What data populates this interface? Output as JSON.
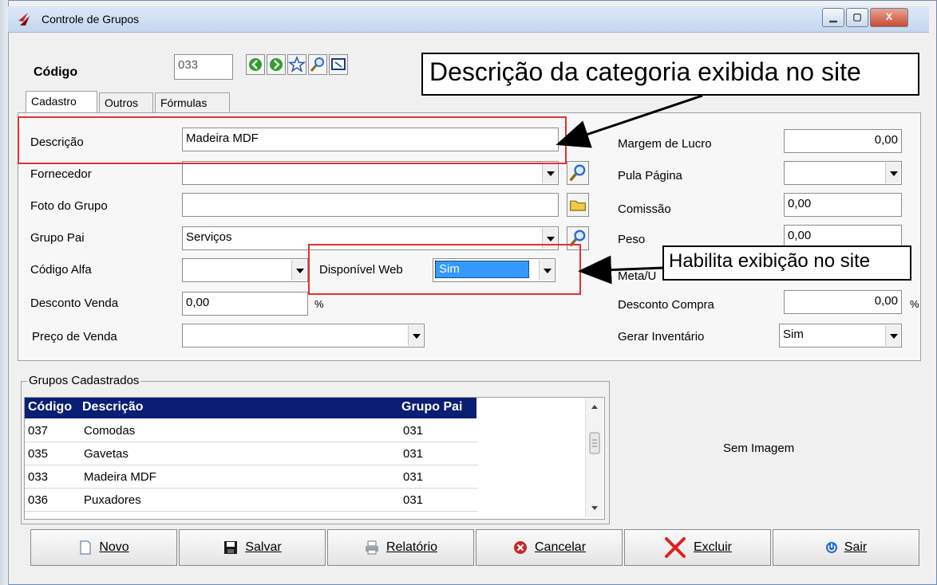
{
  "window": {
    "title": "Controle de Grupos",
    "minimize_glyph": "▁",
    "maximize_glyph": "▢",
    "close_glyph": "X"
  },
  "header": {
    "codigo_label": "Código",
    "codigo_value": "033"
  },
  "tabs": [
    {
      "label": "Cadastro"
    },
    {
      "label": "Outros"
    },
    {
      "label": "Fórmulas"
    }
  ],
  "form_left": {
    "descricao_label": "Descrição",
    "descricao_value": "Madeira MDF",
    "fornecedor_label": "Fornecedor",
    "fornecedor_value": "",
    "foto_label": "Foto do Grupo",
    "foto_value": "",
    "grupo_pai_label": "Grupo Pai",
    "grupo_pai_value": "Serviços",
    "codigo_alfa_label": "Código Alfa",
    "codigo_alfa_value": "",
    "disponivel_web_label": "Disponível Web",
    "disponivel_web_value": "Sim",
    "desconto_venda_label": "Desconto Venda",
    "desconto_venda_value": "0,00",
    "desconto_venda_unit": "%",
    "preco_venda_label": "Preço de Venda",
    "preco_venda_value": ""
  },
  "form_right": {
    "margem_label": "Margem de Lucro",
    "margem_value": "0,00",
    "pula_label": "Pula Página",
    "pula_value": "",
    "comissao_label": "Comissão",
    "comissao_value": "0,00",
    "peso_label": "Peso",
    "peso_value": "0,00",
    "meta_label": "Meta/U",
    "desconto_compra_label": "Desconto Compra",
    "desconto_compra_value": "0,00",
    "desconto_compra_unit": "%",
    "inventario_label": "Gerar Inventário",
    "inventario_value": "Sim"
  },
  "callouts": {
    "descricao": "Descrição da categoria exibida no site",
    "web": "Habilita exibição no site"
  },
  "groups": {
    "legend": "Grupos Cadastrados",
    "columns": [
      "Código",
      "Descrição",
      "Grupo Pai"
    ],
    "rows": [
      {
        "codigo": "037",
        "descricao": "Comodas",
        "grupo_pai": "031"
      },
      {
        "codigo": "035",
        "descricao": "Gavetas",
        "grupo_pai": "031"
      },
      {
        "codigo": "033",
        "descricao": "Madeira MDF",
        "grupo_pai": "031"
      },
      {
        "codigo": "036",
        "descricao": "Puxadores",
        "grupo_pai": "031"
      }
    ],
    "no_image": "Sem Imagem"
  },
  "buttons": {
    "novo": "Novo",
    "salvar": "Salvar",
    "relatorio": "Relatório",
    "cancelar": "Cancelar",
    "excluir": "Excluir",
    "sair": "Sair"
  },
  "colors": {
    "grid_header": "#0a1e73",
    "selection": "#3399ff",
    "annotation_red": "#e53030"
  }
}
